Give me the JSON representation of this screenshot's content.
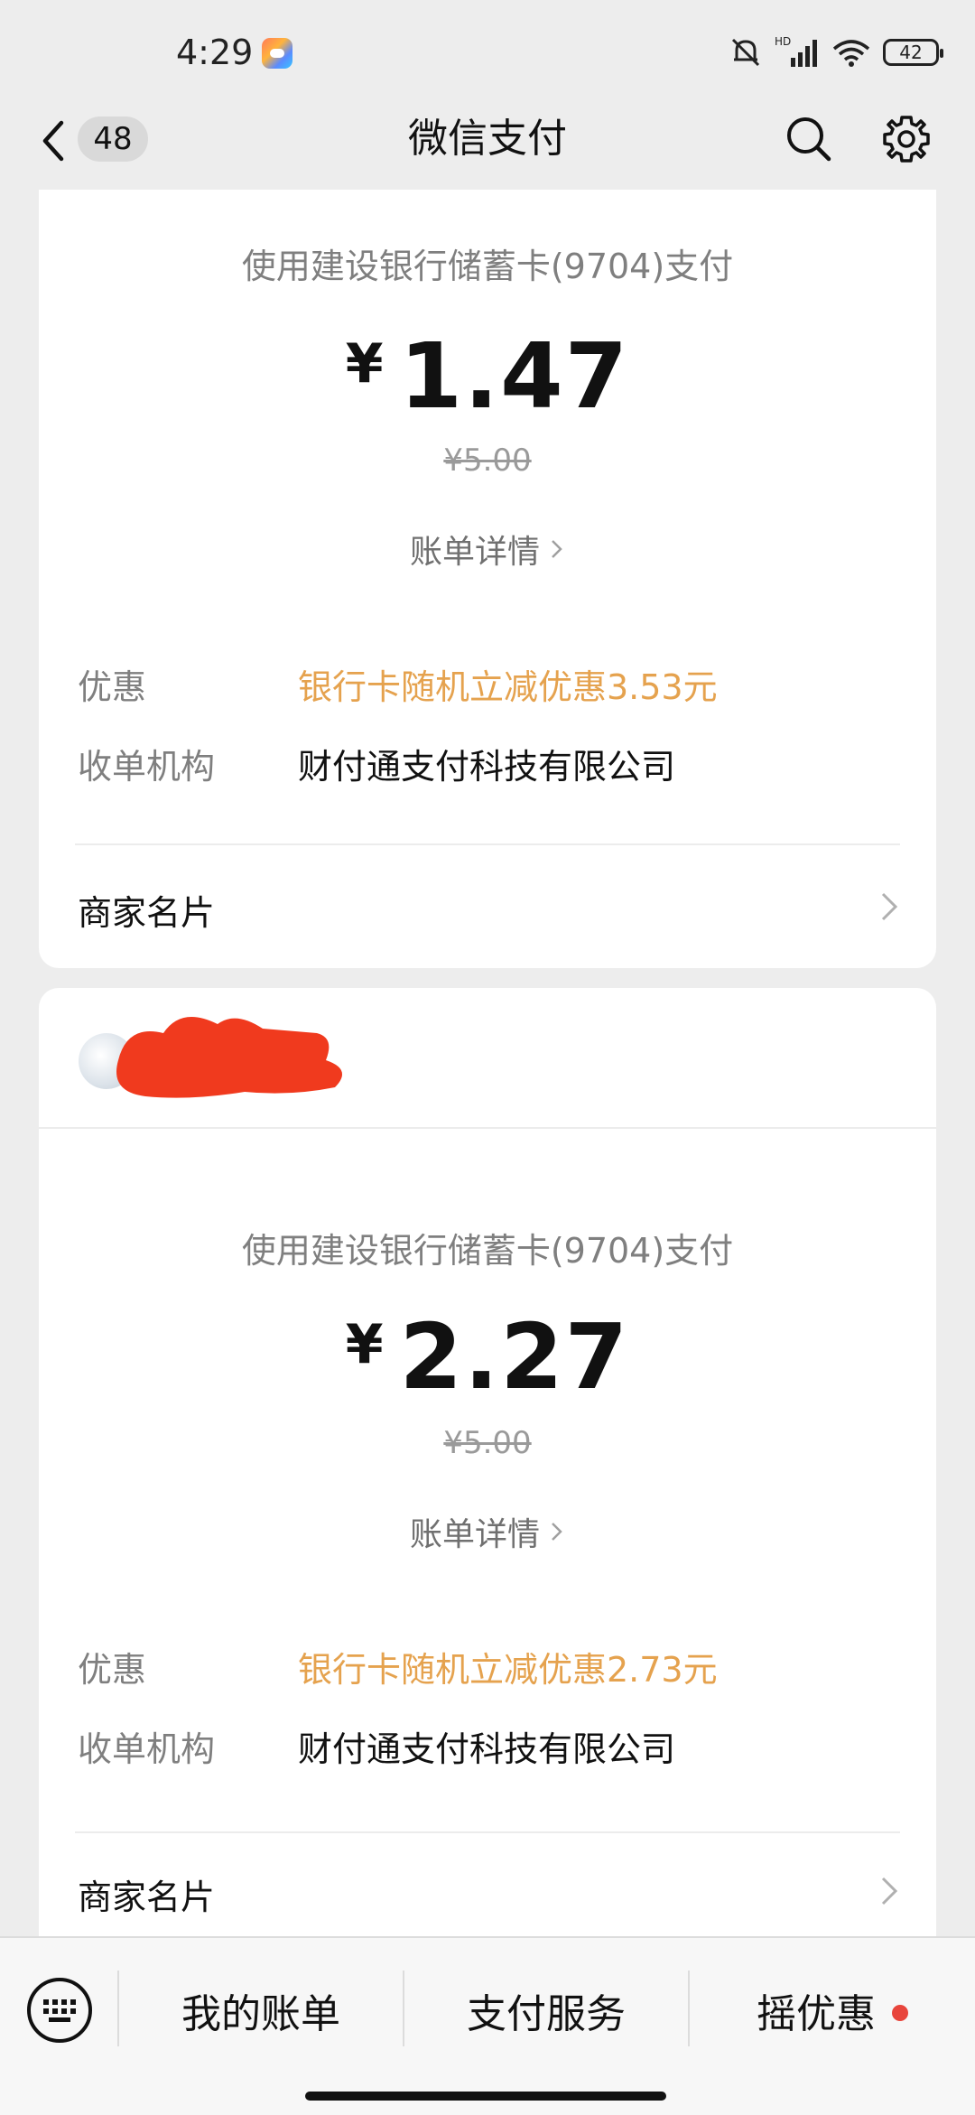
{
  "status_bar": {
    "time": "4:29",
    "battery": "42",
    "network": "HD"
  },
  "navbar": {
    "back_count": "48",
    "title": "微信支付",
    "icons": [
      "back-chevron-icon",
      "search-icon",
      "gear-icon"
    ]
  },
  "transactions": [
    {
      "pay_method": "使用建设银行储蓄卡(9704)支付",
      "currency": "¥",
      "amount": "1.47",
      "original_amount": "¥5.00",
      "bill_detail_label": "账单详情",
      "discount_label": "优惠",
      "discount_value": "银行卡随机立减优惠3.53元",
      "acquirer_label": "收单机构",
      "acquirer_value": "财付通支付科技有限公司",
      "merchant_card_label": "商家名片"
    },
    {
      "pay_method": "使用建设银行储蓄卡(9704)支付",
      "currency": "¥",
      "amount": "2.27",
      "original_amount": "¥5.00",
      "bill_detail_label": "账单详情",
      "discount_label": "优惠",
      "discount_value": "银行卡随机立减优惠2.73元",
      "acquirer_label": "收单机构",
      "acquirer_value": "财付通支付科技有限公司",
      "merchant_card_label": "商家名片"
    }
  ],
  "bottom_bar": {
    "tabs": [
      "我的账单",
      "支付服务",
      "摇优惠"
    ]
  },
  "colors": {
    "background": "#ededed",
    "card": "#ffffff",
    "discount_orange": "#e5a24e",
    "muted_text": "#7f7f7f",
    "red_dot": "#e8453c",
    "redaction": "#f03a1e"
  }
}
